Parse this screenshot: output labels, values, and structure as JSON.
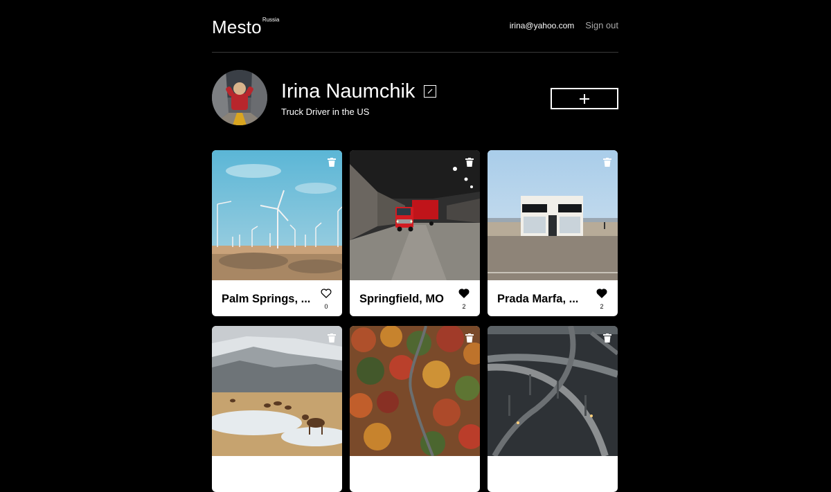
{
  "header": {
    "logo": "Mesto",
    "logo_sup": "Russia",
    "email": "irina@yahoo.com",
    "signout": "Sign out"
  },
  "profile": {
    "name": "Irina Naumchik",
    "job": "Truck Driver in the US"
  },
  "cards": [
    {
      "title": "Palm Springs, ...",
      "likes": "0",
      "liked": false
    },
    {
      "title": "Springfield, MO",
      "likes": "2",
      "liked": true
    },
    {
      "title": "Prada Marfa, ...",
      "likes": "2",
      "liked": true
    },
    {
      "title": "",
      "likes": "",
      "liked": false
    },
    {
      "title": "",
      "likes": "",
      "liked": false
    },
    {
      "title": "",
      "likes": "",
      "liked": false
    }
  ],
  "icons": {
    "edit": "pencil-icon",
    "add": "plus-icon",
    "delete": "trash-icon",
    "like": "heart-icon"
  }
}
